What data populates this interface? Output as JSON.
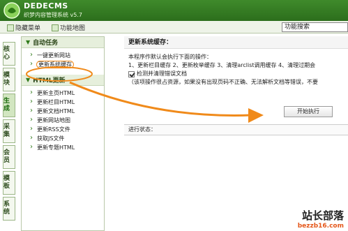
{
  "header": {
    "brand": "DEDECMS",
    "subtitle": "织梦内容管理系统 v5.7",
    "icon": "dede-logo-icon"
  },
  "toolbar": {
    "hide_menu": "隐藏菜单",
    "site_map": "功能地图",
    "search": "功能搜索"
  },
  "tabs": [
    "核心",
    "模块",
    "生成",
    "采集",
    "会员",
    "模板",
    "系统"
  ],
  "active_tab": "生成",
  "left": {
    "sections": [
      {
        "title": "自动任务",
        "items": [
          "一键更新网站",
          "更新系统缓存"
        ]
      },
      {
        "title": "HTML更新",
        "items": [
          "更新主页HTML",
          "更新栏目HTML",
          "更新文档HTML",
          "更新网站地图",
          "更新RSS文件",
          "获取JS文件",
          "更新专题HTML"
        ]
      }
    ],
    "highlighted_item": "更新系统缓存"
  },
  "right": {
    "title": "更新系统缓存：",
    "desc1": "本程序作默认会执行下面的操作：",
    "desc2": "1、更新栏目缓存 2、更新枚举缓存 3、清理arclist调用缓存 4、清理过期会",
    "checkbox_label": "检测并清理错误文档",
    "note": "（该项操作很占资源，如果没有出现页码不正确、无法解析文档等错误，不要",
    "start_button": "开始执行",
    "status_label": "进行状态："
  },
  "watermark": {
    "title": "站长部落",
    "url": "bezzb16.com"
  },
  "colors": {
    "header_green": "#2c6e1c",
    "accent_orange": "#f08a1a"
  }
}
